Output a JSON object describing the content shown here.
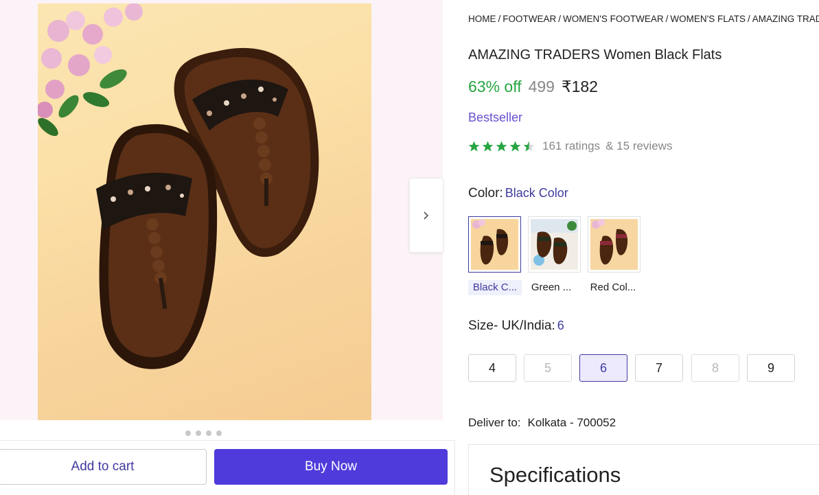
{
  "breadcrumb": {
    "items": [
      "HOME",
      "FOOTWEAR",
      "WOMEN'S FOOTWEAR",
      "WOMEN'S FLATS",
      "AMAZING TRADERS"
    ],
    "separator": "/"
  },
  "product": {
    "title": "AMAZING TRADERS Women Black Flats",
    "discount": "63% off",
    "mrp": "499",
    "price": "₹182",
    "badge": "Bestseller",
    "rating": 4.5,
    "ratings_text": "161 ratings",
    "reviews_text": "& 15 reviews"
  },
  "color": {
    "label": "Color:",
    "selected": "Black Color",
    "options": [
      {
        "label": "Black C...",
        "active": true
      },
      {
        "label": "Green ...",
        "active": false
      },
      {
        "label": "Red Col...",
        "active": false
      }
    ]
  },
  "size": {
    "label": "Size- UK/India:",
    "selected": "6",
    "options": [
      {
        "label": "4",
        "state": "available"
      },
      {
        "label": "5",
        "state": "disabled"
      },
      {
        "label": "6",
        "state": "selected"
      },
      {
        "label": "7",
        "state": "available"
      },
      {
        "label": "8",
        "state": "disabled"
      },
      {
        "label": "9",
        "state": "available"
      }
    ]
  },
  "delivery": {
    "label": "Deliver to:",
    "location": "Kolkata - 700052"
  },
  "specifications": {
    "title": "Specifications"
  },
  "actions": {
    "add_to_cart": "Add to cart",
    "buy_now": "Buy Now"
  },
  "icons": {
    "next": "chevron-right-icon",
    "star": "star-icon"
  },
  "colors": {
    "accent": "#4f3bdc",
    "link": "#3f3a9e",
    "discount": "#26a541",
    "star": "#26a541",
    "badge": "#6a4fcf"
  }
}
